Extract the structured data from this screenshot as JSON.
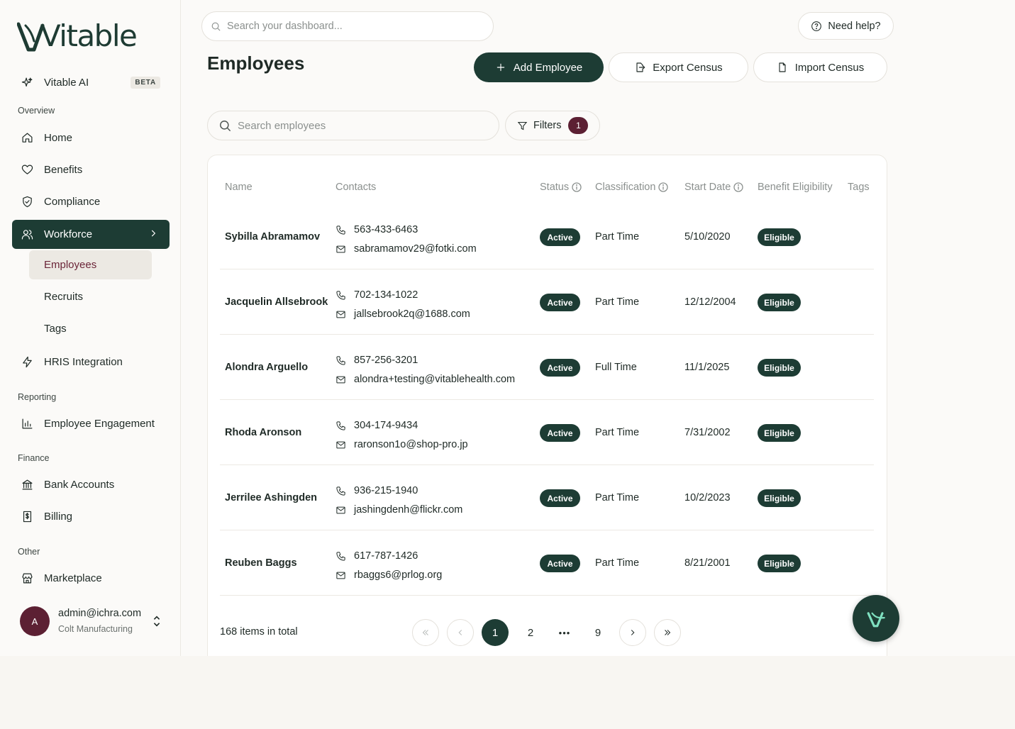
{
  "brand": {
    "logo_text": "Vitable"
  },
  "sidebar": {
    "ai_item": {
      "label": "Vitable AI",
      "badge": "BETA"
    },
    "sections": {
      "overview": "Overview",
      "reporting": "Reporting",
      "finance": "Finance",
      "other": "Other"
    },
    "items": {
      "home": "Home",
      "benefits": "Benefits",
      "compliance": "Compliance",
      "workforce": "Workforce",
      "employees": "Employees",
      "recruits": "Recruits",
      "tags": "Tags",
      "hris": "HRIS Integration",
      "engagement": "Employee Engagement",
      "bank_accounts": "Bank Accounts",
      "billing": "Billing",
      "marketplace": "Marketplace"
    },
    "user": {
      "initial": "A",
      "email": "admin@ichra.com",
      "company": "Colt Manufacturing"
    }
  },
  "topbar": {
    "search_placeholder": "Search your dashboard...",
    "help_label": "Need help?"
  },
  "page": {
    "title": "Employees",
    "add_label": "Add Employee",
    "export_label": "Export Census",
    "import_label": "Import Census",
    "search_placeholder": "Search employees",
    "filters_label": "Filters",
    "filters_count": "1"
  },
  "table": {
    "headers": {
      "name": "Name",
      "contacts": "Contacts",
      "status": "Status",
      "classification": "Classification",
      "start_date": "Start Date",
      "eligibility": "Benefit Eligibility",
      "tags": "Tags"
    },
    "rows": [
      {
        "name": "Sybilla Abramamov",
        "phone": "563-433-6463",
        "email": "sabramamov29@fotki.com",
        "status": "Active",
        "classification": "Part Time",
        "start_date": "5/10/2020",
        "eligibility": "Eligible"
      },
      {
        "name": "Jacquelin Allsebrook",
        "phone": "702-134-1022",
        "email": "jallsebrook2q@1688.com",
        "status": "Active",
        "classification": "Part Time",
        "start_date": "12/12/2004",
        "eligibility": "Eligible"
      },
      {
        "name": "Alondra Arguello",
        "phone": "857-256-3201",
        "email": "alondra+testing@vitablehealth.com",
        "status": "Active",
        "classification": "Full Time",
        "start_date": "11/1/2025",
        "eligibility": "Eligible"
      },
      {
        "name": "Rhoda Aronson",
        "phone": "304-174-9434",
        "email": "raronson1o@shop-pro.jp",
        "status": "Active",
        "classification": "Part Time",
        "start_date": "7/31/2002",
        "eligibility": "Eligible"
      },
      {
        "name": "Jerrilee Ashingden",
        "phone": "936-215-1940",
        "email": "jashingdenh@flickr.com",
        "status": "Active",
        "classification": "Part Time",
        "start_date": "10/2/2023",
        "eligibility": "Eligible"
      },
      {
        "name": "Reuben Baggs",
        "phone": "617-787-1426",
        "email": "rbaggs6@prlog.org",
        "status": "Active",
        "classification": "Part Time",
        "start_date": "8/21/2001",
        "eligibility": "Eligible"
      }
    ]
  },
  "pagination": {
    "total_label": "168 items in total",
    "current": "1",
    "page_2": "2",
    "ellipsis": "•••",
    "last": "9"
  },
  "colors": {
    "primary": "#1d3c34",
    "accent": "#5c2033",
    "active_sub_text": "#6b2538"
  }
}
